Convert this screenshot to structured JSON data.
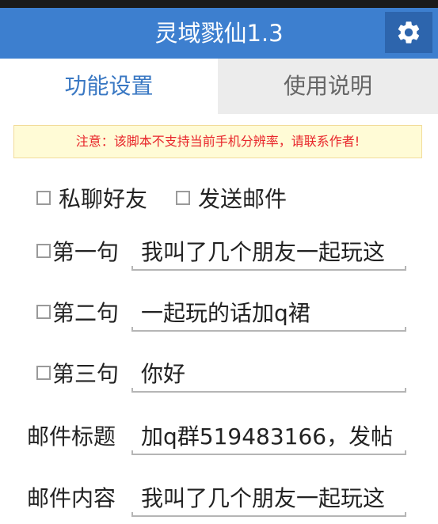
{
  "app": {
    "title": "灵域戮仙1.3"
  },
  "tabs": [
    {
      "label": "功能设置",
      "active": true
    },
    {
      "label": "使用说明",
      "active": false
    }
  ],
  "notice": "注意：该脚本不支持当前手机分辨率，请联系作者!",
  "options": {
    "private_chat_label": "私聊好友",
    "send_mail_label": "发送邮件"
  },
  "sentences": [
    {
      "label": "第一句",
      "value": "我叫了几个朋友一起玩这"
    },
    {
      "label": "第二句",
      "value": "一起玩的话加q裙"
    },
    {
      "label": "第三句",
      "value": "你好"
    }
  ],
  "mail": {
    "title_label": "邮件标题",
    "title_value": "加q群519483166，发帖",
    "content_label": "邮件内容",
    "content_value": "我叫了几个朋友一起玩这"
  },
  "colors": {
    "accent": "#3d7fcf",
    "notice_text": "#e8262b",
    "notice_bg": "#fffbd6"
  },
  "icons": {
    "settings": "gear-icon"
  }
}
